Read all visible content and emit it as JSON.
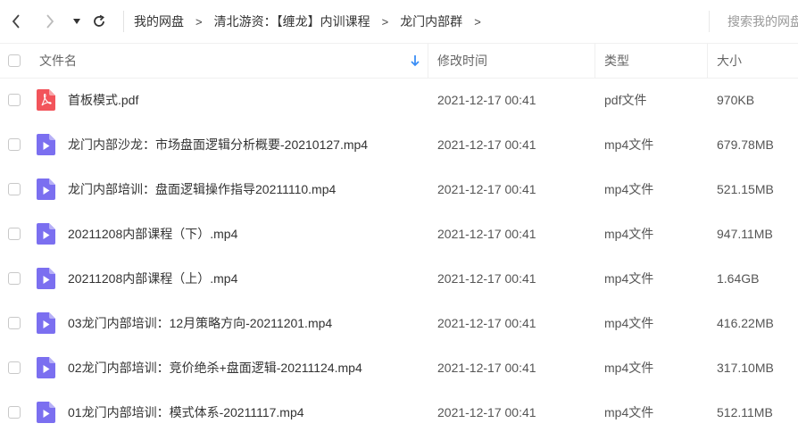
{
  "toolbar": {
    "breadcrumbs": [
      "我的网盘",
      "清北游资：【缠龙】内训课程",
      "龙门内部群"
    ],
    "breadcrumb_separator": ">",
    "search_placeholder": "搜索我的网盘文件"
  },
  "header": {
    "name": "文件名",
    "modified": "修改时间",
    "type": "类型",
    "size": "大小"
  },
  "colors": {
    "pdf_icon": "#f2545b",
    "video_icon": "#7b6ff0",
    "sort_arrow": "#3a8ef6"
  },
  "files": [
    {
      "name": "首板模式.pdf",
      "modified": "2021-12-17 00:41",
      "type": "pdf文件",
      "size": "970KB",
      "icon": "pdf-icon"
    },
    {
      "name": "龙门内部沙龙：市场盘面逻辑分析概要-20210127.mp4",
      "modified": "2021-12-17 00:41",
      "type": "mp4文件",
      "size": "679.78MB",
      "icon": "video-icon"
    },
    {
      "name": "龙门内部培训：盘面逻辑操作指导20211110.mp4",
      "modified": "2021-12-17 00:41",
      "type": "mp4文件",
      "size": "521.15MB",
      "icon": "video-icon"
    },
    {
      "name": "20211208内部课程（下）.mp4",
      "modified": "2021-12-17 00:41",
      "type": "mp4文件",
      "size": "947.11MB",
      "icon": "video-icon"
    },
    {
      "name": "20211208内部课程（上）.mp4",
      "modified": "2021-12-17 00:41",
      "type": "mp4文件",
      "size": "1.64GB",
      "icon": "video-icon"
    },
    {
      "name": "03龙门内部培训：12月策略方向-20211201.mp4",
      "modified": "2021-12-17 00:41",
      "type": "mp4文件",
      "size": "416.22MB",
      "icon": "video-icon"
    },
    {
      "name": "02龙门内部培训：竞价绝杀+盘面逻辑-20211124.mp4",
      "modified": "2021-12-17 00:41",
      "type": "mp4文件",
      "size": "317.10MB",
      "icon": "video-icon"
    },
    {
      "name": "01龙门内部培训：模式体系-20211117.mp4",
      "modified": "2021-12-17 00:41",
      "type": "mp4文件",
      "size": "512.11MB",
      "icon": "video-icon"
    }
  ]
}
